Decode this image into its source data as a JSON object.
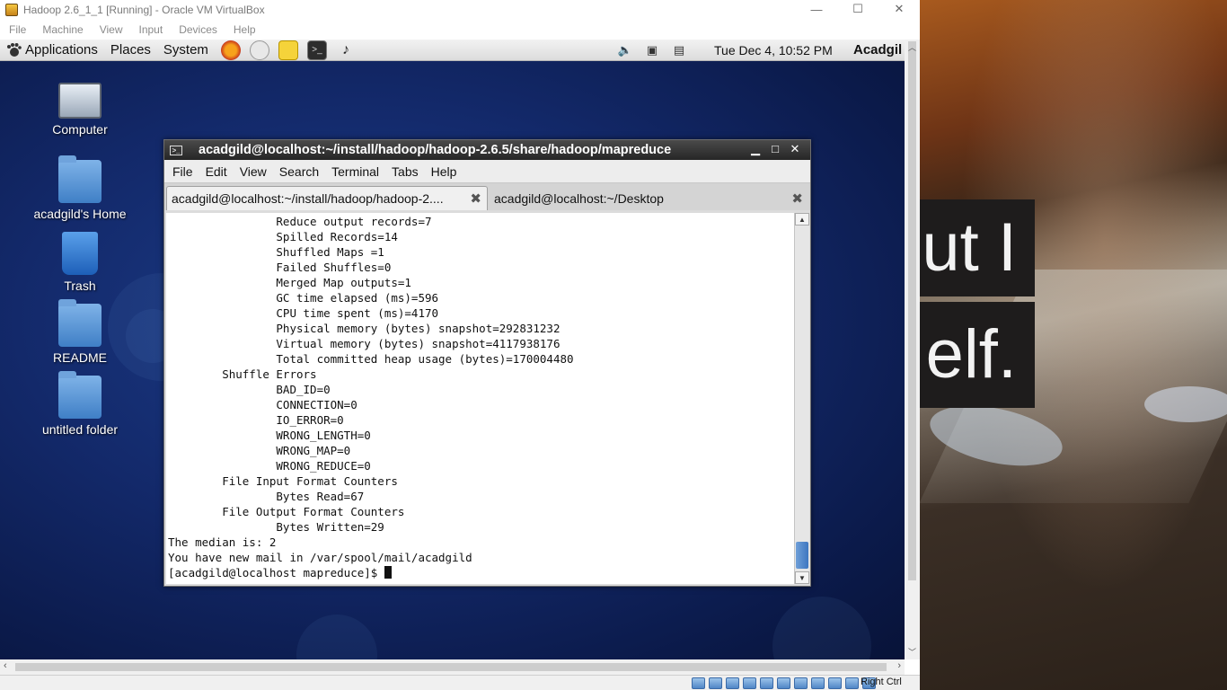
{
  "host_window": {
    "title": "Hadoop 2.6_1_1 [Running] - Oracle VM VirtualBox",
    "menu": [
      "File",
      "Machine",
      "View",
      "Input",
      "Devices",
      "Help"
    ],
    "controls": [
      "—",
      "☐",
      "✕"
    ],
    "host_key_label": "Right Ctrl"
  },
  "gnome_panel": {
    "menus": [
      "Applications",
      "Places",
      "System"
    ],
    "launchers": [
      "firefox-icon",
      "evolution-icon",
      "notes-icon",
      "terminal-icon",
      "sound-juicer-icon"
    ],
    "clock": "Tue Dec  4, 10:52 PM",
    "user": "Acadgil"
  },
  "desktop_icons": [
    {
      "label": "Computer",
      "icon": "computer-icon"
    },
    {
      "label": "acadgild's Home",
      "icon": "home-folder-icon"
    },
    {
      "label": "Trash",
      "icon": "trash-icon"
    },
    {
      "label": "README",
      "icon": "folder-icon"
    },
    {
      "label": "untitled folder",
      "icon": "folder-icon"
    }
  ],
  "terminal": {
    "title": "acadgild@localhost:~/install/hadoop/hadoop-2.6.5/share/hadoop/mapreduce",
    "menu": [
      "File",
      "Edit",
      "View",
      "Search",
      "Terminal",
      "Tabs",
      "Help"
    ],
    "tabs": [
      {
        "label": "acadgild@localhost:~/install/hadoop/hadoop-2....",
        "active": true
      },
      {
        "label": "acadgild@localhost:~/Desktop",
        "active": false
      }
    ],
    "lines": [
      "                Reduce output records=7",
      "                Spilled Records=14",
      "                Shuffled Maps =1",
      "                Failed Shuffles=0",
      "                Merged Map outputs=1",
      "                GC time elapsed (ms)=596",
      "                CPU time spent (ms)=4170",
      "                Physical memory (bytes) snapshot=292831232",
      "                Virtual memory (bytes) snapshot=4117938176",
      "                Total committed heap usage (bytes)=170004480",
      "        Shuffle Errors",
      "                BAD_ID=0",
      "                CONNECTION=0",
      "                IO_ERROR=0",
      "                WRONG_LENGTH=0",
      "                WRONG_MAP=0",
      "                WRONG_REDUCE=0",
      "        File Input Format Counters",
      "                Bytes Read=67",
      "        File Output Format Counters",
      "                Bytes Written=29",
      "The median is: 2",
      "You have new mail in /var/spool/mail/acadgild"
    ],
    "prompt": "[acadgild@localhost mapreduce]$ "
  },
  "wallpaper_text": [
    "ut I",
    "elf."
  ],
  "colors": {
    "desktop_blue": "#13296a",
    "panel_gray": "#dcdcdc",
    "terminal_title_dark": "#262626"
  }
}
